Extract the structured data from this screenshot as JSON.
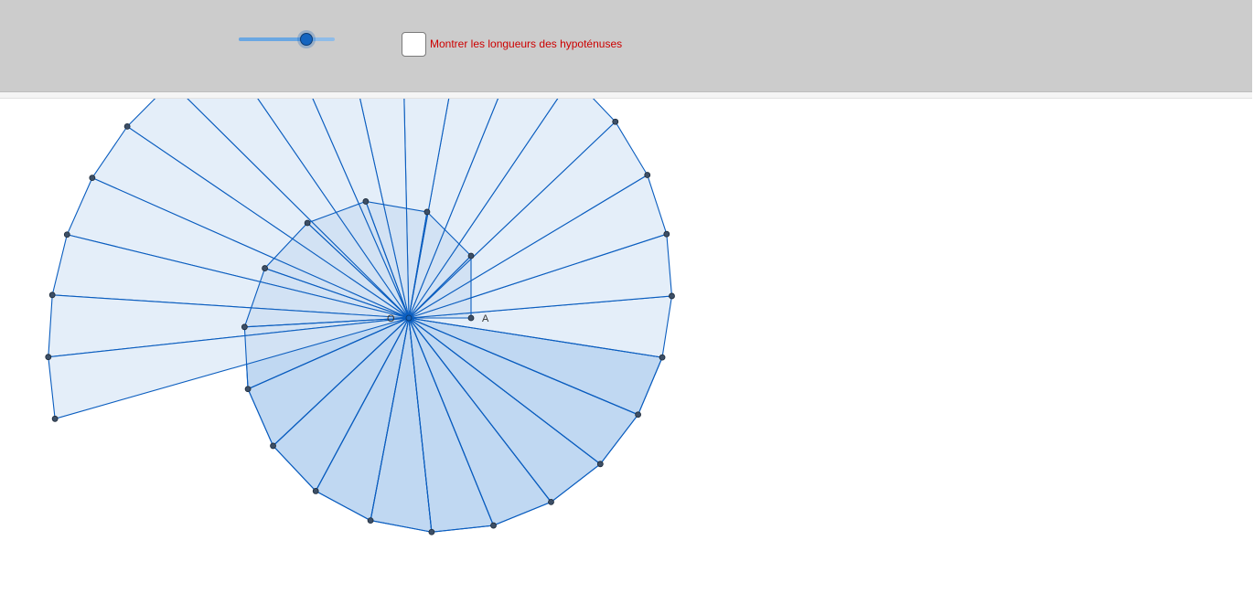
{
  "slider": {
    "value": 0.7
  },
  "checkbox": {
    "label": "Montrer les longueurs des hypoténuses",
    "checked": false
  },
  "geometry": {
    "center_label": "O",
    "start_point_label": "A",
    "triangle_count": 34
  },
  "colors": {
    "toolbar_background": "#cccccc",
    "label_red": "#cc0000",
    "fill_light": "#e4eef9",
    "fill_dark": "#d0e2f6",
    "line_blue": "#0a5dbf",
    "point_fill": "#3d4f66",
    "slider_accent": "#1565c0"
  }
}
